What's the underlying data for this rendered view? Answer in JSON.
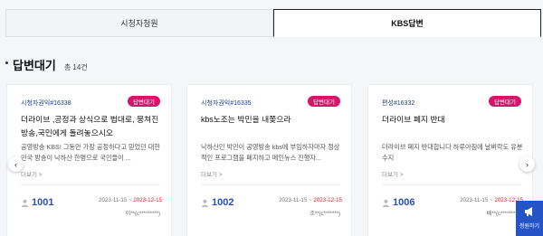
{
  "tabs": [
    {
      "label": "시청자청원"
    },
    {
      "label": "KBS답변"
    }
  ],
  "section": {
    "title": "답변대기",
    "count": "총 14건"
  },
  "cards": [
    {
      "category": "시청자권익#16338",
      "badge": "답변대기",
      "title": "더라이브 ,공정과 상식으로 법대로, 뭉쳐진방송,국민에게 돌려놓으시오",
      "body": "공영방송 KBS! 그동안 가장 공정하다고 믿었던 대한민국 방송이 낙하산 한명으로 국민들이 ...",
      "more": "더보기 >",
      "votes": "1001",
      "date_start": "2023-11-15",
      "date_sep": " ~ ",
      "date_end": "2023-12-15",
      "author": "이**(c*********)"
    },
    {
      "category": "시청자권익#16335",
      "badge": "답변대기",
      "title": "kbs노조는 박민을 내쫒으라",
      "body": "낙하산인 박민이 공영방송 kbs에 부임하자마자 정상적인 프로그램을 폐지하고 메인뉴스 진행자...",
      "more": "더보기 >",
      "votes": "1002",
      "date_start": "2023-11-15",
      "date_sep": " ~ ",
      "date_end": "2023-12-15",
      "author": "조**(c*******)"
    },
    {
      "category": "편성#16332",
      "badge": "답변대기",
      "title": "더라이브 폐지 반대",
      "body": "더라이브 폐지 반대합니다 하루아침에 날벼락도 유분수지",
      "more": "더보기 >",
      "votes": "1006",
      "date_start": "2023-11-15",
      "date_sep": " ~ ",
      "date_end": "2023-12-15",
      "author": "배**(c*********)"
    }
  ],
  "arrows": {
    "prev": "‹",
    "next": "›"
  },
  "fab": {
    "label": "청원하기"
  },
  "colors": {
    "accent": "#d6146b",
    "brand_blue": "#2554c7",
    "end_date": "#e01c2b"
  }
}
